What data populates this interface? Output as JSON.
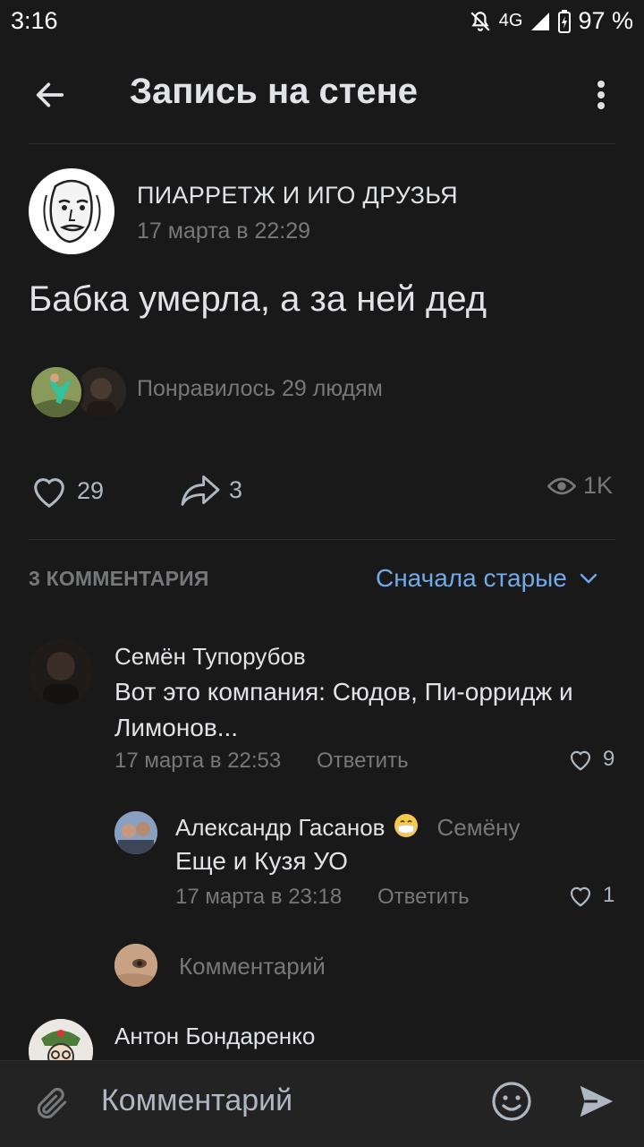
{
  "status_bar": {
    "time": "3:16",
    "network": "4G",
    "battery": "97 %"
  },
  "header": {
    "title": "Запись на стене"
  },
  "post": {
    "author": "ПИАРРЕТЖ И ИГО ДРУЗЬЯ",
    "date": "17 марта в 22:29",
    "text": "Бабка умерла, а за ней дед",
    "liked_by": "Понравилось 29 людям",
    "likes": "29",
    "shares": "3",
    "views": "1K"
  },
  "comments_section": {
    "count_label": "3 КОММЕНТАРИЯ",
    "sort_label": "Сначала старые"
  },
  "comments": [
    {
      "name": "Семён Тупорубов",
      "text_line1": "Вот это компания: Сюдов, Пи-орридж и",
      "text_line2": "Лимонов...",
      "date": "17 марта в 22:53",
      "reply_label": "Ответить",
      "likes": "9"
    },
    {
      "name": "Александр Гасанов",
      "to": "Семёну",
      "text": "Еще и Кузя УО",
      "date": "17 марта в 23:18",
      "reply_label": "Ответить",
      "likes": "1"
    },
    {
      "name": "Антон Бондаренко"
    }
  ],
  "reply_field": {
    "placeholder": "Комментарий"
  },
  "bottom_bar": {
    "placeholder": "Комментарий"
  },
  "colors": {
    "background": "#19191a",
    "accent": "#71aaeb",
    "secondary_text": "#76787a"
  }
}
